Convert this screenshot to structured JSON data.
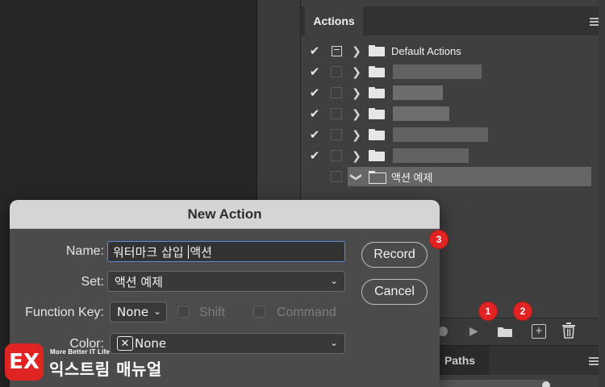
{
  "actions_panel": {
    "tab_label": "Actions",
    "sets": [
      {
        "checked": true,
        "dialog": true,
        "expanded": false,
        "name": "Default Actions"
      },
      {
        "checked": true,
        "dialog": false,
        "expanded": false,
        "name": ""
      },
      {
        "checked": true,
        "dialog": false,
        "expanded": false,
        "name": ""
      },
      {
        "checked": true,
        "dialog": false,
        "expanded": false,
        "name": ""
      },
      {
        "checked": true,
        "dialog": false,
        "expanded": false,
        "name": ""
      },
      {
        "checked": true,
        "dialog": false,
        "expanded": false,
        "name": ""
      },
      {
        "checked": false,
        "dialog": false,
        "expanded": true,
        "name": "액션 예제",
        "selected": true
      }
    ],
    "check_glyph": "✔",
    "collapsed_glyph": "❯",
    "expanded_glyph": "❯"
  },
  "lower_panel": {
    "tab_label": "Paths"
  },
  "badges": [
    "1",
    "2",
    "3"
  ],
  "dialog": {
    "title": "New Action",
    "name_label": "Name:",
    "name_value_before_caret": "워터마크 삽입 ",
    "name_value_after_caret": "액션",
    "set_label": "Set:",
    "set_value": "액션 예제",
    "function_key_label": "Function Key:",
    "function_key_value": "None",
    "shift_label": "Shift",
    "command_label": "Command",
    "color_label": "Color:",
    "color_value": "None",
    "record_button": "Record",
    "cancel_button": "Cancel"
  },
  "logo": {
    "mark": "EX",
    "tagline": "More Better IT Life",
    "name": "익스트림 매뉴얼"
  },
  "colors": {
    "badge": "#e02424",
    "input_focus": "#5a8fd6",
    "selected_row": "#666666"
  }
}
